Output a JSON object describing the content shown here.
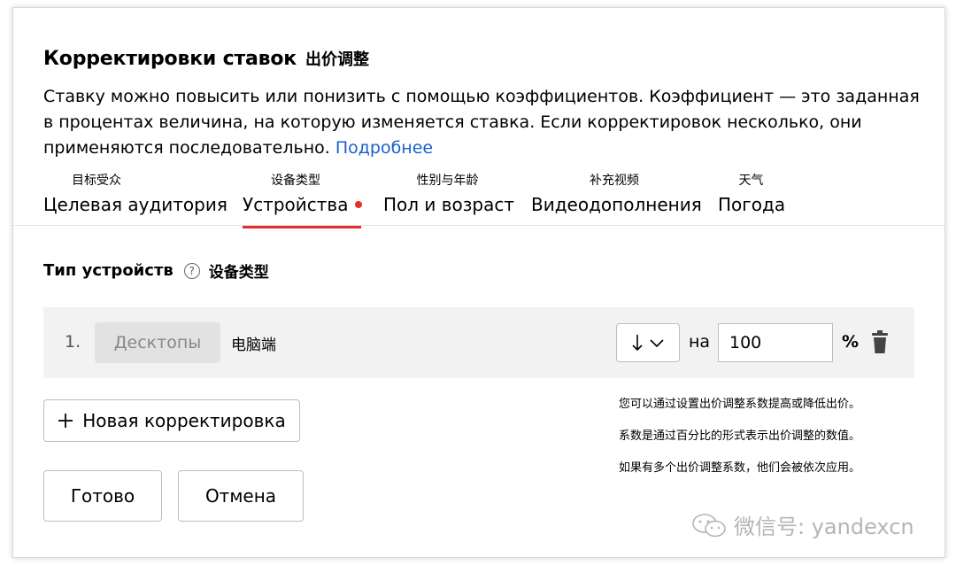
{
  "header": {
    "title": "Корректировки ставок",
    "title_cn": "出价调整",
    "description": "Ставку можно повысить или понизить с помощью коэффициентов. Коэффициент — это заданная в процентах величина, на которую изменяется ставка. Если корректировок несколько, они применяются последовательно.",
    "more_link": "Подробнее"
  },
  "tabs": [
    {
      "cn": "目标受众",
      "label": "Целевая аудитория"
    },
    {
      "cn": "设备类型",
      "label": "Устройства",
      "active": true
    },
    {
      "cn": "性别与年龄",
      "label": "Пол и возраст"
    },
    {
      "cn": "补充视频",
      "label": "Видеодополнения"
    },
    {
      "cn": "天气",
      "label": "Погода"
    }
  ],
  "section": {
    "title": "Тип устройств",
    "title_cn": "设备类型",
    "help_icon": "question-circle-icon"
  },
  "adjustment": {
    "number": "1.",
    "device": "Десктопы",
    "device_cn": "电脑端",
    "direction_icon": "arrow-down-icon",
    "on_label": "на",
    "value": "100",
    "unit": "%",
    "delete_icon": "trash-icon"
  },
  "buttons": {
    "add_icon": "plus-icon",
    "add_label": "Новая корректировка",
    "done": "Готово",
    "cancel": "Отмена"
  },
  "notes": [
    "您可以通过设置出价调整系数提高或降低出价。",
    "系数是通过百分比的形式表示出价调整的数值。",
    "如果有多个出价调整系数，他们会被依次应用。"
  ],
  "watermark": "微信号: yandexcn",
  "colors": {
    "accent_red": "#e62e2e",
    "link_blue": "#1a5fd0",
    "row_bg": "#f2f2f2"
  }
}
